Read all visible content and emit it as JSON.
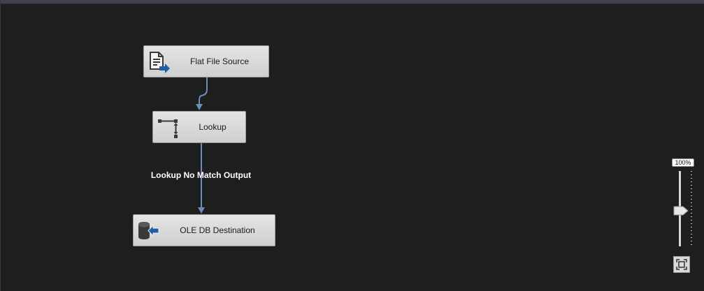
{
  "tasks": {
    "flat_file_source": {
      "label": "Flat File Source",
      "icon": "flat-file-source-icon"
    },
    "lookup": {
      "label": "Lookup",
      "icon": "lookup-icon"
    },
    "ole_db_destination": {
      "label": "OLE DB Destination",
      "icon": "ole-db-destination-icon"
    }
  },
  "paths": {
    "lookup_to_destination_label": "Lookup No Match Output"
  },
  "zoom": {
    "readout": "100%",
    "level_percent": 100
  },
  "colors": {
    "canvas": "#1e1e1e",
    "connector": "#6d8ebd",
    "icon_blue": "#1f5fa8"
  }
}
